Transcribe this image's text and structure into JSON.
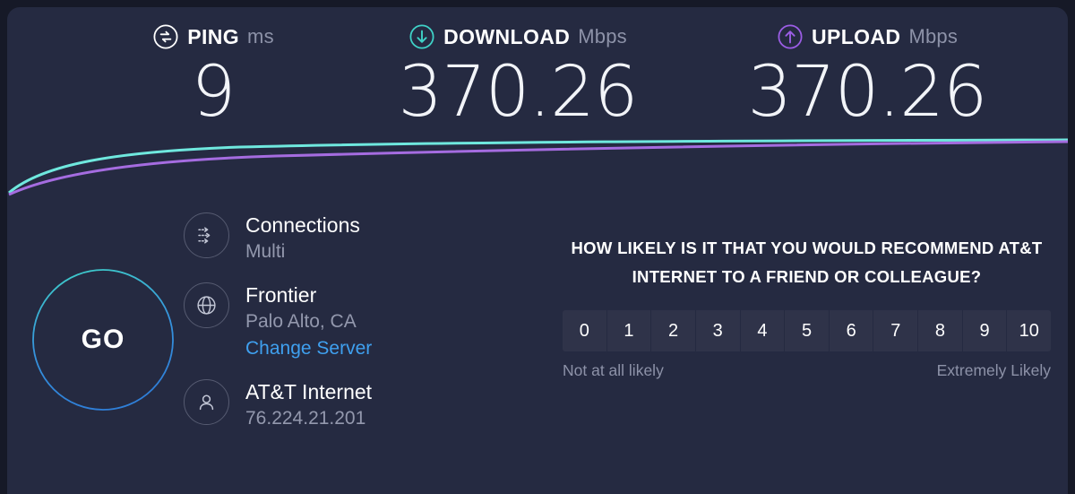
{
  "metrics": [
    {
      "icon": "ping-icon",
      "label": "PING",
      "unit": "ms",
      "value": "9",
      "color": "#ffffff"
    },
    {
      "icon": "download-arrow-icon",
      "label": "DOWNLOAD",
      "unit": "Mbps",
      "value": "370.26",
      "color": "#3fd2c7"
    },
    {
      "icon": "upload-arrow-icon",
      "label": "UPLOAD",
      "unit": "Mbps",
      "value": "370.26",
      "color": "#9b5de5"
    }
  ],
  "graph": {
    "download_color": "#6fe8de",
    "upload_color": "#a56ce0"
  },
  "go_button": {
    "label": "GO",
    "ring_top_color": "#3fd2c7",
    "ring_bottom_color": "#2f7fd8"
  },
  "info": {
    "connections": {
      "icon": "connections-icon",
      "title": "Connections",
      "sub": "Multi"
    },
    "server": {
      "icon": "globe-icon",
      "title": "Frontier",
      "sub": "Palo Alto, CA",
      "link": "Change Server"
    },
    "isp": {
      "icon": "person-icon",
      "title": "AT&T Internet",
      "sub": "76.224.21.201"
    }
  },
  "survey": {
    "question": "HOW LIKELY IS IT THAT YOU WOULD RECOMMEND AT&T INTERNET TO A FRIEND OR COLLEAGUE?",
    "options": [
      "0",
      "1",
      "2",
      "3",
      "4",
      "5",
      "6",
      "7",
      "8",
      "9",
      "10"
    ],
    "low_label": "Not at all likely",
    "high_label": "Extremely Likely"
  }
}
